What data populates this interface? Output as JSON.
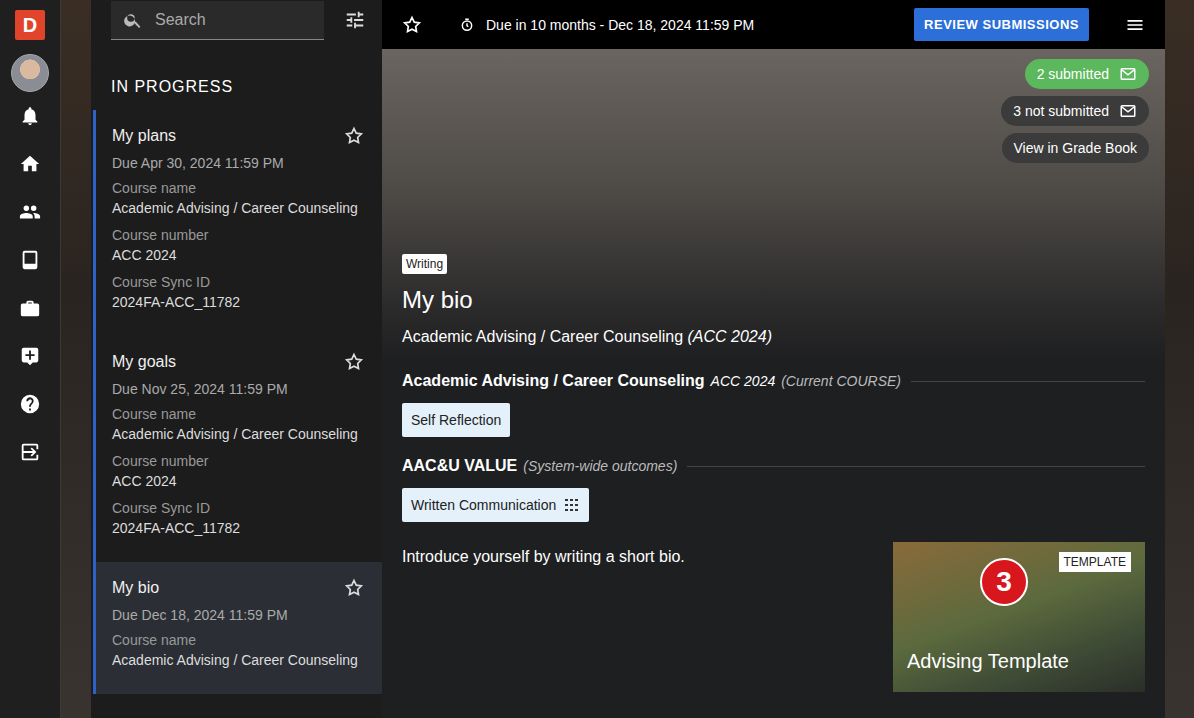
{
  "rail": {
    "logo": "D"
  },
  "search": {
    "placeholder": "Search"
  },
  "list": {
    "heading": "IN PROGRESS",
    "items": [
      {
        "title": "My plans",
        "due": "Due Apr 30, 2024 11:59 PM",
        "starred": false,
        "selected": false,
        "fields": [
          {
            "label": "Course name",
            "value": "Academic Advising / Career Counseling"
          },
          {
            "label": "Course number",
            "value": "ACC 2024"
          },
          {
            "label": "Course Sync ID",
            "value": "2024FA-ACC_11782"
          }
        ]
      },
      {
        "title": "My goals",
        "due": "Due Nov 25, 2024 11:59 PM",
        "starred": false,
        "selected": false,
        "fields": [
          {
            "label": "Course name",
            "value": "Academic Advising / Career Counseling"
          },
          {
            "label": "Course number",
            "value": "ACC 2024"
          },
          {
            "label": "Course Sync ID",
            "value": "2024FA-ACC_11782"
          }
        ]
      },
      {
        "title": "My bio",
        "due": "Due Dec 18, 2024 11:59 PM",
        "starred": false,
        "selected": true,
        "fields": [
          {
            "label": "Course name",
            "value": "Academic Advising / Career Counseling"
          }
        ]
      }
    ]
  },
  "topbar": {
    "starred": false,
    "due": "Due in 10 months - Dec 18, 2024 11:59 PM",
    "review_button": "REVIEW SUBMISSIONS"
  },
  "status_pills": [
    {
      "label": "2 submitted",
      "color": "#5cb85c"
    },
    {
      "label": "3 not submitted",
      "color": "#3b3b3b"
    }
  ],
  "grade_book": "View in Grade Book",
  "assignment": {
    "type": "Writing",
    "title": "My bio",
    "course": "Academic Advising / Career Counseling",
    "course_number": "(ACC 2024)"
  },
  "outcome_groups": [
    {
      "title": "Academic Advising / Career Counseling",
      "code": "ACC 2024",
      "note": "(Current COURSE)",
      "chips": [
        {
          "label": "Self Reflection",
          "rubric": false
        }
      ]
    },
    {
      "title": "AAC&U VALUE",
      "note": "(System-wide outcomes)",
      "chips": [
        {
          "label": "Written Communication",
          "rubric": true
        }
      ]
    }
  ],
  "description": "Introduce yourself by writing a short bio.",
  "template": {
    "tag": "TEMPLATE",
    "badge": "3",
    "title": "Advising Template"
  }
}
